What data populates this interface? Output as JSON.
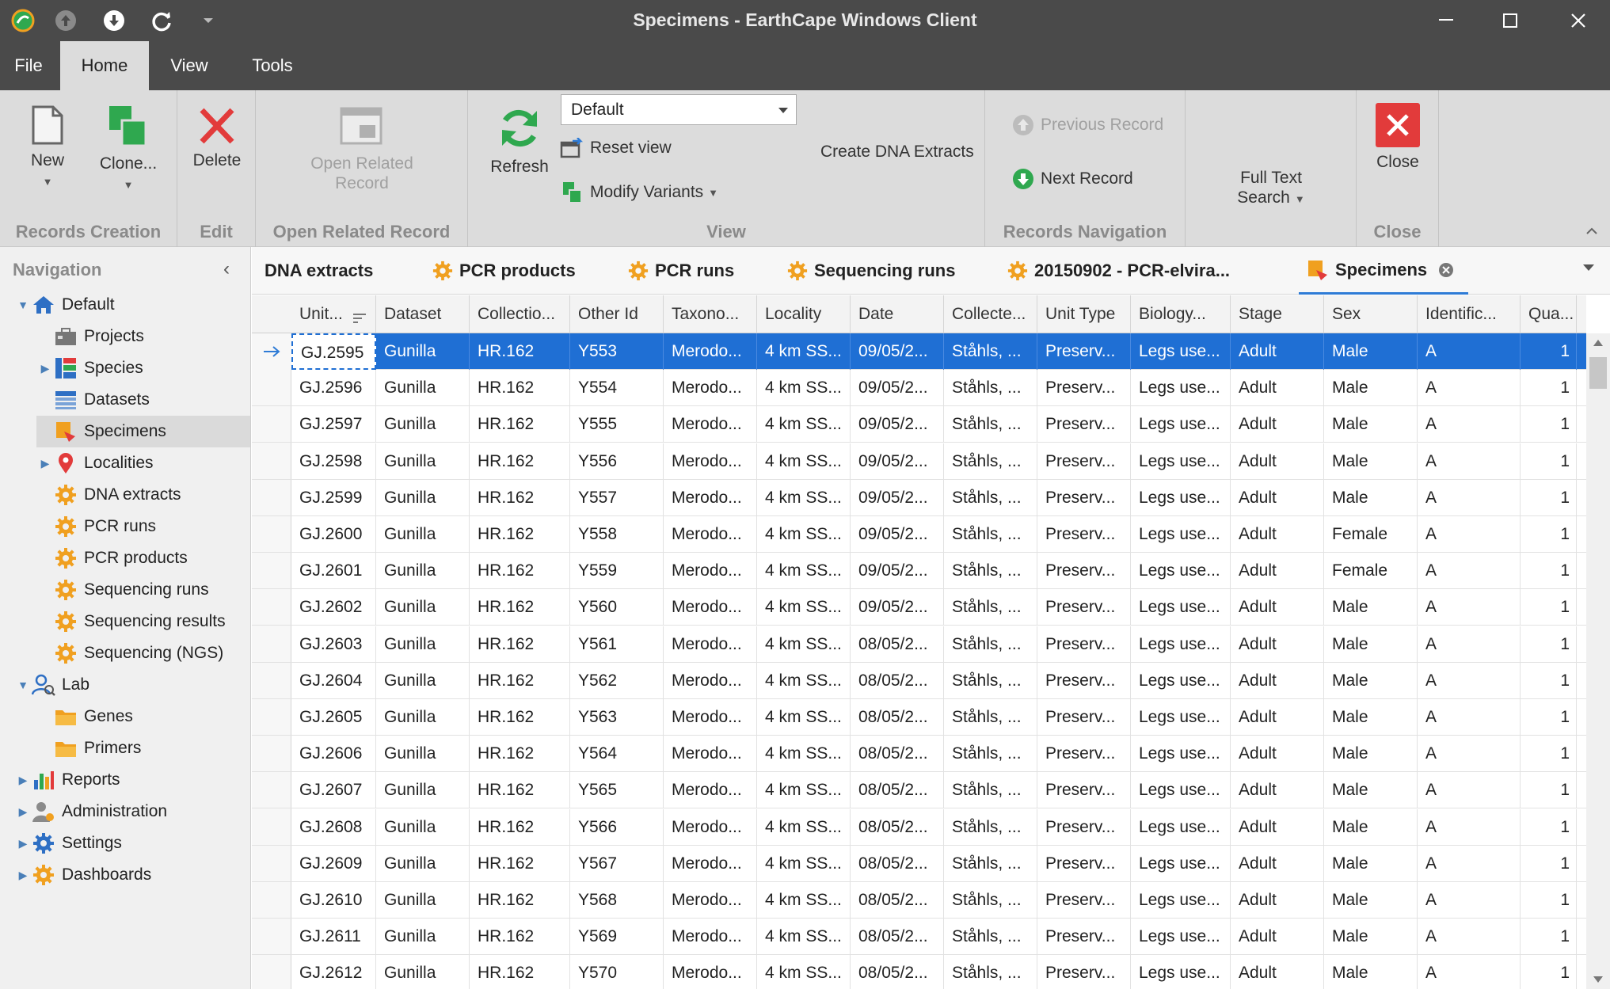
{
  "window": {
    "title": "Specimens - EarthCape Windows Client"
  },
  "menu": {
    "tabs": [
      "File",
      "Home",
      "View",
      "Tools"
    ]
  },
  "ribbon": {
    "records_creation": {
      "label": "Records Creation",
      "new": "New",
      "clone": "Clone..."
    },
    "edit": {
      "label": "Edit",
      "delete": "Delete"
    },
    "open_related": {
      "label": "Open Related Record",
      "line1": "Open Related",
      "line2": "Record"
    },
    "view": {
      "label": "View",
      "refresh": "Refresh",
      "combo_value": "Default",
      "reset_view": "Reset view",
      "modify_variants": "Modify Variants",
      "create_dna": "Create DNA Extracts"
    },
    "navigation": {
      "label": "Records Navigation",
      "previous": "Previous Record",
      "next": "Next Record"
    },
    "search": {
      "line1": "Full Text",
      "line2": "Search"
    },
    "close": {
      "label": "Close",
      "close": "Close"
    }
  },
  "nav": {
    "header": "Navigation",
    "items": [
      {
        "label": "Default"
      },
      {
        "label": "Projects"
      },
      {
        "label": "Species"
      },
      {
        "label": "Datasets"
      },
      {
        "label": "Specimens"
      },
      {
        "label": "Localities"
      },
      {
        "label": "DNA extracts"
      },
      {
        "label": "PCR runs"
      },
      {
        "label": "PCR products"
      },
      {
        "label": "Sequencing runs"
      },
      {
        "label": "Sequencing results"
      },
      {
        "label": "Sequencing (NGS)"
      },
      {
        "label": "Lab"
      },
      {
        "label": "Genes"
      },
      {
        "label": "Primers"
      },
      {
        "label": "Reports"
      },
      {
        "label": "Administration"
      },
      {
        "label": "Settings"
      },
      {
        "label": "Dashboards"
      }
    ]
  },
  "doc_tabs": [
    "DNA extracts",
    "PCR products",
    "PCR runs",
    "Sequencing runs",
    "20150902 - PCR-elvira...",
    "Specimens"
  ],
  "grid": {
    "columns": [
      "Unit...",
      "Dataset",
      "Collectio...",
      "Other Id",
      "Taxono...",
      "Locality",
      "Date",
      "Collecte...",
      "Unit Type",
      "Biology...",
      "Stage",
      "Sex",
      "Identific...",
      "Qua..."
    ],
    "rows": [
      [
        "GJ.2595",
        "Gunilla",
        "HR.162",
        "Y553",
        "Merodo...",
        "4 km SS...",
        "09/05/2...",
        "Ståhls, ...",
        "Preserv...",
        "Legs use...",
        "Adult",
        "Male",
        "A",
        "1"
      ],
      [
        "GJ.2596",
        "Gunilla",
        "HR.162",
        "Y554",
        "Merodo...",
        "4 km SS...",
        "09/05/2...",
        "Ståhls, ...",
        "Preserv...",
        "Legs use...",
        "Adult",
        "Male",
        "A",
        "1"
      ],
      [
        "GJ.2597",
        "Gunilla",
        "HR.162",
        "Y555",
        "Merodo...",
        "4 km SS...",
        "09/05/2...",
        "Ståhls, ...",
        "Preserv...",
        "Legs use...",
        "Adult",
        "Male",
        "A",
        "1"
      ],
      [
        "GJ.2598",
        "Gunilla",
        "HR.162",
        "Y556",
        "Merodo...",
        "4 km SS...",
        "09/05/2...",
        "Ståhls, ...",
        "Preserv...",
        "Legs use...",
        "Adult",
        "Male",
        "A",
        "1"
      ],
      [
        "GJ.2599",
        "Gunilla",
        "HR.162",
        "Y557",
        "Merodo...",
        "4 km SS...",
        "09/05/2...",
        "Ståhls, ...",
        "Preserv...",
        "Legs use...",
        "Adult",
        "Male",
        "A",
        "1"
      ],
      [
        "GJ.2600",
        "Gunilla",
        "HR.162",
        "Y558",
        "Merodo...",
        "4 km SS...",
        "09/05/2...",
        "Ståhls, ...",
        "Preserv...",
        "Legs use...",
        "Adult",
        "Female",
        "A",
        "1"
      ],
      [
        "GJ.2601",
        "Gunilla",
        "HR.162",
        "Y559",
        "Merodo...",
        "4 km SS...",
        "09/05/2...",
        "Ståhls, ...",
        "Preserv...",
        "Legs use...",
        "Adult",
        "Female",
        "A",
        "1"
      ],
      [
        "GJ.2602",
        "Gunilla",
        "HR.162",
        "Y560",
        "Merodo...",
        "4 km SS...",
        "09/05/2...",
        "Ståhls, ...",
        "Preserv...",
        "Legs use...",
        "Adult",
        "Male",
        "A",
        "1"
      ],
      [
        "GJ.2603",
        "Gunilla",
        "HR.162",
        "Y561",
        "Merodo...",
        "4 km SS...",
        "08/05/2...",
        "Ståhls, ...",
        "Preserv...",
        "Legs use...",
        "Adult",
        "Male",
        "A",
        "1"
      ],
      [
        "GJ.2604",
        "Gunilla",
        "HR.162",
        "Y562",
        "Merodo...",
        "4 km SS...",
        "08/05/2...",
        "Ståhls, ...",
        "Preserv...",
        "Legs use...",
        "Adult",
        "Male",
        "A",
        "1"
      ],
      [
        "GJ.2605",
        "Gunilla",
        "HR.162",
        "Y563",
        "Merodo...",
        "4 km SS...",
        "08/05/2...",
        "Ståhls, ...",
        "Preserv...",
        "Legs use...",
        "Adult",
        "Male",
        "A",
        "1"
      ],
      [
        "GJ.2606",
        "Gunilla",
        "HR.162",
        "Y564",
        "Merodo...",
        "4 km SS...",
        "08/05/2...",
        "Ståhls, ...",
        "Preserv...",
        "Legs use...",
        "Adult",
        "Male",
        "A",
        "1"
      ],
      [
        "GJ.2607",
        "Gunilla",
        "HR.162",
        "Y565",
        "Merodo...",
        "4 km SS...",
        "08/05/2...",
        "Ståhls, ...",
        "Preserv...",
        "Legs use...",
        "Adult",
        "Male",
        "A",
        "1"
      ],
      [
        "GJ.2608",
        "Gunilla",
        "HR.162",
        "Y566",
        "Merodo...",
        "4 km SS...",
        "08/05/2...",
        "Ståhls, ...",
        "Preserv...",
        "Legs use...",
        "Adult",
        "Male",
        "A",
        "1"
      ],
      [
        "GJ.2609",
        "Gunilla",
        "HR.162",
        "Y567",
        "Merodo...",
        "4 km SS...",
        "08/05/2...",
        "Ståhls, ...",
        "Preserv...",
        "Legs use...",
        "Adult",
        "Male",
        "A",
        "1"
      ],
      [
        "GJ.2610",
        "Gunilla",
        "HR.162",
        "Y568",
        "Merodo...",
        "4 km SS...",
        "08/05/2...",
        "Ståhls, ...",
        "Preserv...",
        "Legs use...",
        "Adult",
        "Male",
        "A",
        "1"
      ],
      [
        "GJ.2611",
        "Gunilla",
        "HR.162",
        "Y569",
        "Merodo...",
        "4 km SS...",
        "08/05/2...",
        "Ståhls, ...",
        "Preserv...",
        "Legs use...",
        "Adult",
        "Male",
        "A",
        "1"
      ],
      [
        "GJ.2612",
        "Gunilla",
        "HR.162",
        "Y570",
        "Merodo...",
        "4 km SS...",
        "08/05/2...",
        "Ståhls, ...",
        "Preserv...",
        "Legs use...",
        "Adult",
        "Male",
        "A",
        "1"
      ]
    ]
  },
  "colors": {
    "accent": "#1f6fd4",
    "chrome": "#4a4a4a",
    "ribbon": "#dcdcdc",
    "delete": "#e23b3b",
    "green": "#2fa84f",
    "orange": "#f0a020"
  }
}
